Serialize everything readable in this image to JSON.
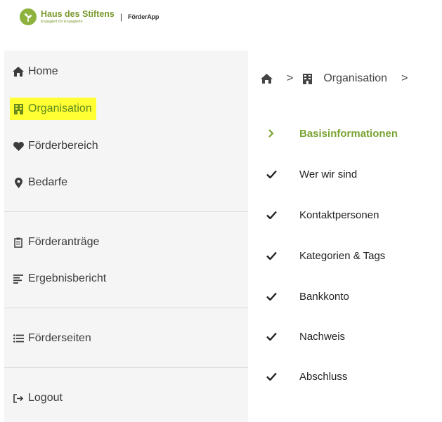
{
  "header": {
    "brand_name": "Haus des Stiftens",
    "brand_tagline": "Engagiert für Engagierte",
    "separator": "|",
    "app_name": "FörderApp",
    "brand_color": "#8db33e"
  },
  "sidebar": {
    "items": [
      {
        "label": "Home",
        "icon": "home-icon"
      },
      {
        "label": "Organisation",
        "icon": "building-icon",
        "active": true
      },
      {
        "label": "Förderbereich",
        "icon": "heart-icon"
      },
      {
        "label": "Bedarfe",
        "icon": "map-marker-icon"
      },
      {
        "label": "Förderanträge",
        "icon": "clipboard-icon"
      },
      {
        "label": "Ergebnisbericht",
        "icon": "align-left-icon"
      },
      {
        "label": "Förderseiten",
        "icon": "list-icon"
      },
      {
        "label": "Logout",
        "icon": "logout-icon"
      }
    ],
    "highlight_color": "#ffff33",
    "active_color": "#5c8a1e"
  },
  "breadcrumb": {
    "home_icon": "home-icon",
    "separator": ">",
    "org_icon": "building-icon",
    "current": "Organisation",
    "trailing_separator": ">"
  },
  "steps": [
    {
      "label": "Basisinformationen",
      "state": "current"
    },
    {
      "label": "Wer wir sind",
      "state": "done"
    },
    {
      "label": "Kontaktpersonen",
      "state": "done"
    },
    {
      "label": "Kategorien & Tags",
      "state": "done"
    },
    {
      "label": "Bankkonto",
      "state": "done"
    },
    {
      "label": "Nachweis",
      "state": "done"
    },
    {
      "label": "Abschluss",
      "state": "done"
    }
  ],
  "colors": {
    "step_current": "#7aa333",
    "sidebar_bg": "#f5f5f5"
  }
}
